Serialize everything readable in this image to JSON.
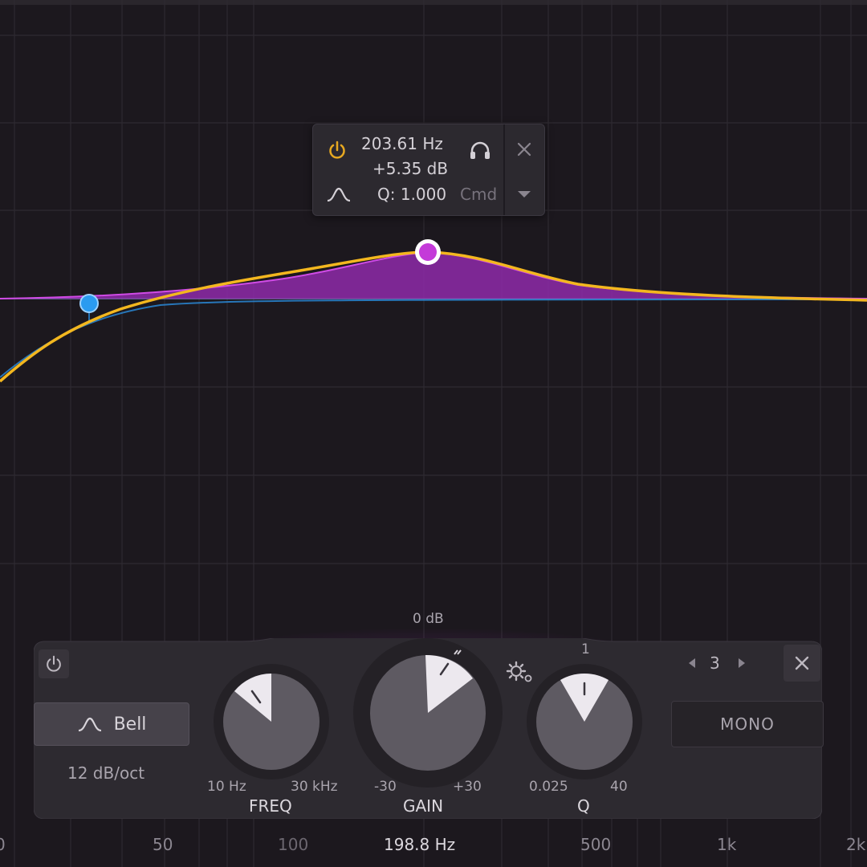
{
  "tooltip": {
    "frequency": "203.61 Hz",
    "gain": "+5.35 dB",
    "q": "Q: 1.000",
    "modifier": "Cmd"
  },
  "band_panel": {
    "shape_label": "Bell",
    "slope": "12 dB/oct",
    "gain_top": "0 dB",
    "q_top": "1",
    "band_number": "3",
    "stereo_label": "MONO",
    "knobs": [
      {
        "name": "FREQ",
        "min": "10 Hz",
        "max": "30 kHz"
      },
      {
        "name": "GAIN",
        "min": "-30",
        "max": "+30"
      },
      {
        "name": "Q",
        "min": "0.025",
        "max": "40"
      }
    ]
  },
  "freq_axis": {
    "ticks": [
      "50",
      "100",
      "500",
      "1k",
      "2k"
    ],
    "first_tick_partial": "0",
    "cursor_readout": "198.8 Hz"
  },
  "colors": {
    "background": "#1c181e",
    "accent_purple": "#c43ad9",
    "curve_yellow": "#f3b71f",
    "low_band_blue": "#2a9bf0",
    "power_on": "#e7a821"
  },
  "icons": {
    "tooltip_power": "power-icon",
    "tooltip_solo": "headphones-icon",
    "tooltip_close": "close-icon",
    "tooltip_shape": "bell-shape-icon",
    "tooltip_menu": "chevron-down-icon",
    "panel_power": "power-icon",
    "panel_close": "close-icon",
    "panel_settings": "gear-icon",
    "band_prev": "triangle-left-icon",
    "band_next": "triangle-right-icon"
  }
}
